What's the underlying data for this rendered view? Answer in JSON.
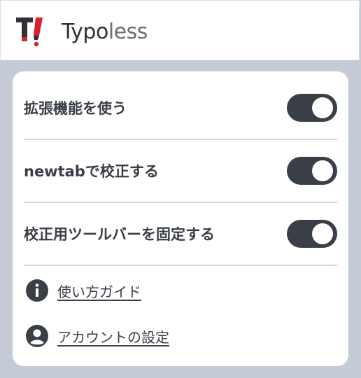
{
  "header": {
    "brand_part1": "Typo",
    "brand_part2": "less",
    "logo_icon": "typoless-logo-icon"
  },
  "settings": [
    {
      "label": "拡張機能を使う",
      "enabled": true
    },
    {
      "label": "newtabで校正する",
      "enabled": true
    },
    {
      "label": "校正用ツールバーを固定する",
      "enabled": true
    }
  ],
  "links": [
    {
      "label": "使い方ガイド",
      "icon": "info-icon"
    },
    {
      "label": "アカウントの設定",
      "icon": "account-icon"
    }
  ],
  "colors": {
    "toggle_on": "#3a3e46",
    "background": "#c5cbd6",
    "brand_red": "#d6222a"
  }
}
